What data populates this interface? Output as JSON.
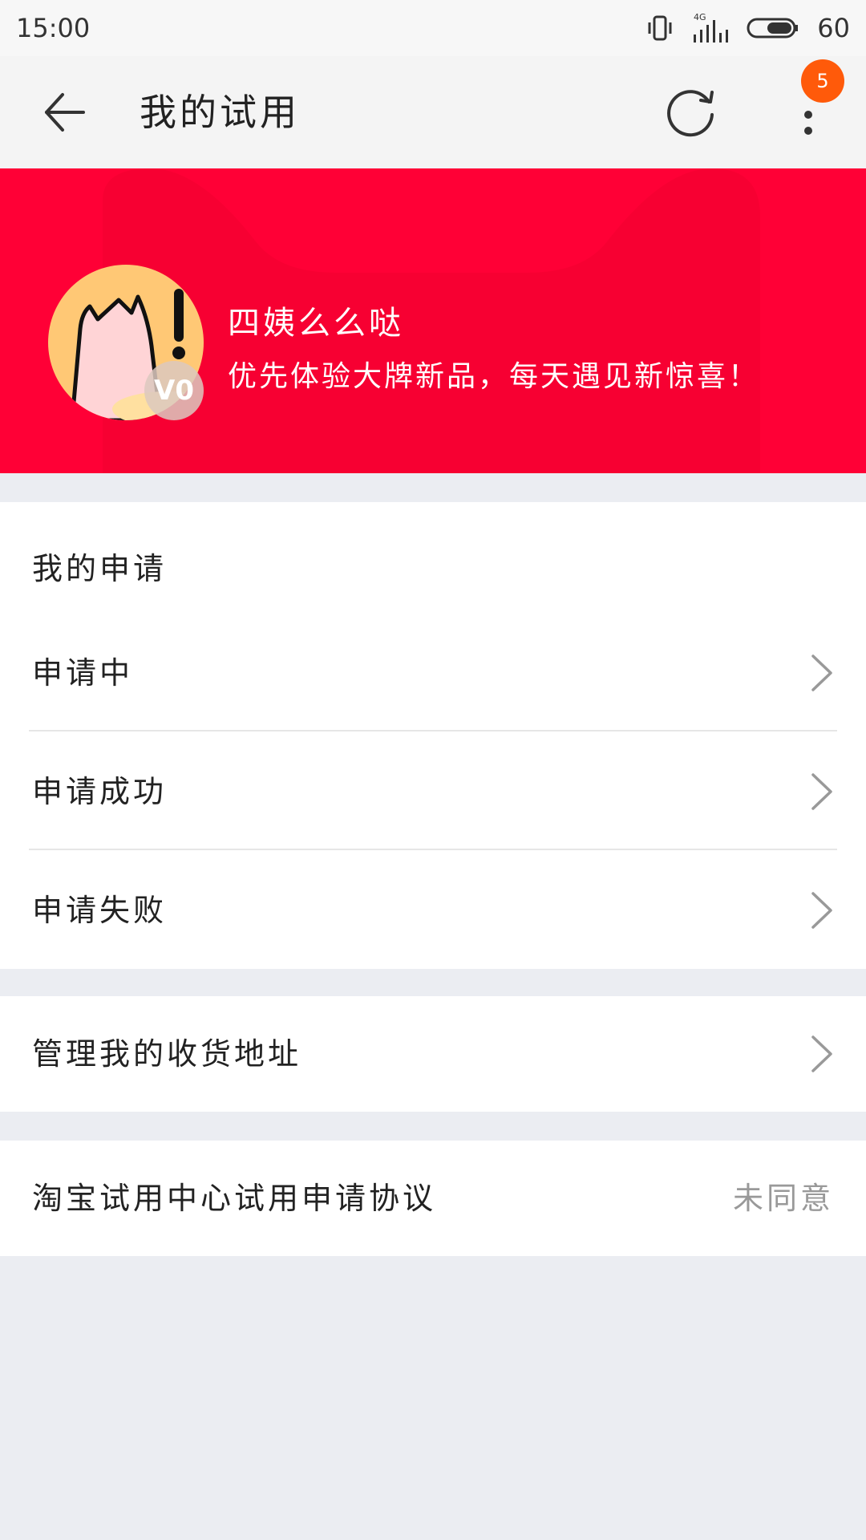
{
  "status_bar": {
    "time": "15:00",
    "network": "4G",
    "battery": "60"
  },
  "header": {
    "title": "我的试用",
    "back_icon": "arrow-left-icon",
    "refresh_icon": "refresh-icon",
    "more_icon": "more-vertical-icon",
    "badge_count": "5"
  },
  "profile": {
    "name": "四姨么么哒",
    "slogan": "优先体验大牌新品，每天遇见新惊喜！",
    "level": "V0"
  },
  "applications": {
    "header": "我的申请",
    "items": [
      {
        "label": "申请中"
      },
      {
        "label": "申请成功"
      },
      {
        "label": "申请失败"
      }
    ]
  },
  "address": {
    "label": "管理我的收货地址"
  },
  "agreement": {
    "label": "淘宝试用中心试用申请协议",
    "status": "未同意"
  },
  "colors": {
    "brand_red": "#ff0036",
    "badge_orange": "#ff5a0a",
    "background": "#ebedf2"
  }
}
